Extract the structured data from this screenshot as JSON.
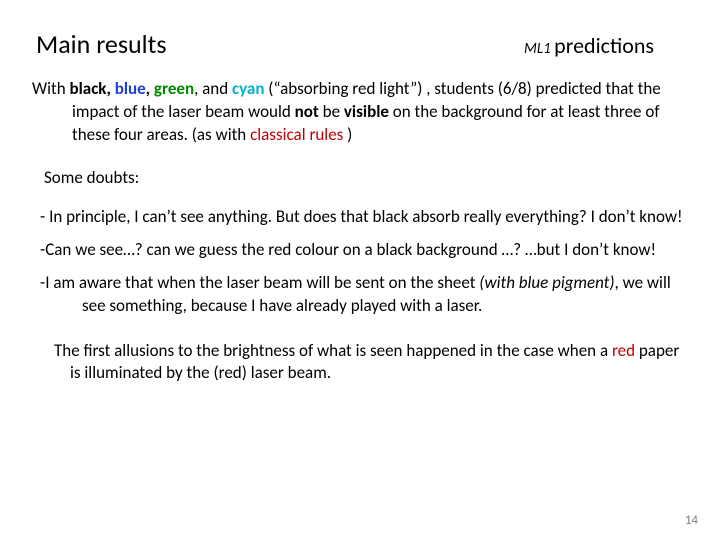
{
  "header": {
    "left": "Main results",
    "right_prefix": "ML1 ",
    "right_word": "predictions"
  },
  "p1": {
    "t0": "With ",
    "black": "black",
    "c1": ", ",
    "blue": "blue",
    "c2": ", ",
    "green": "green",
    "c3": ", and ",
    "cyan": "cyan ",
    "t1": "(“absorbing red light”) , students (6/8) predicted that the impact of the laser beam would ",
    "not": "not ",
    "be": "be ",
    "visible": "visible ",
    "t2": "on the background for at least three of these four areas. (as with ",
    "classical": "classical rules",
    "t3": " )"
  },
  "doubts": "Some doubts:",
  "r1": {
    "dash": "- ",
    "text": "In principle, I can’t see anything. But does that black absorb really everything? I don’t know!"
  },
  "r2": {
    "dash": "-",
    "text": "Can we see…? can we guess the red colour on a black background …? …but I don’t know!"
  },
  "r3": {
    "dash": "-",
    "plain": "I am aware that when the laser beam will be sent on the sheet  ",
    "italic": "(with blue pigment)",
    "rest": ", we will see something, because I have already played with a laser."
  },
  "final": {
    "t0": "The first allusions to the brightness of what is seen  happened in the case when a ",
    "red": "red ",
    "t1": "paper is  illuminated by the (red) laser beam."
  },
  "page": "14"
}
